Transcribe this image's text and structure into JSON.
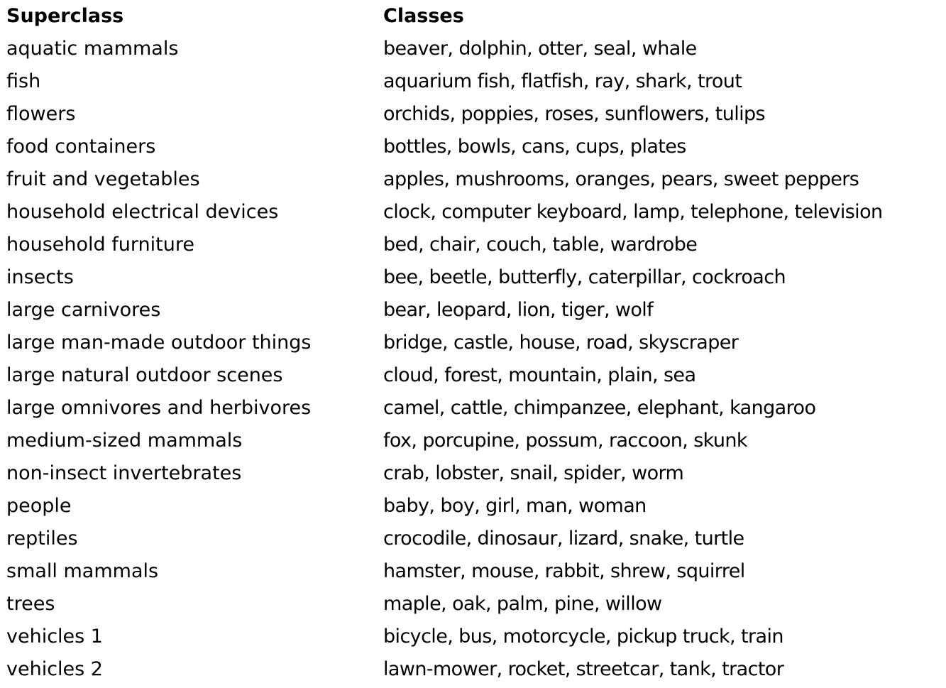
{
  "table": {
    "headers": {
      "superclass": "Superclass",
      "classes": "Classes"
    },
    "rows": [
      {
        "superclass": "aquatic mammals",
        "classes": "beaver, dolphin, otter, seal, whale"
      },
      {
        "superclass": "fish",
        "classes": "aquarium fish, flatfish, ray, shark, trout"
      },
      {
        "superclass": "flowers",
        "classes": "orchids, poppies, roses, sunflowers, tulips"
      },
      {
        "superclass": "food containers",
        "classes": "bottles, bowls, cans, cups, plates"
      },
      {
        "superclass": "fruit and vegetables",
        "classes": "apples, mushrooms, oranges, pears, sweet peppers"
      },
      {
        "superclass": "household electrical devices",
        "classes": "clock, computer keyboard, lamp, telephone, television"
      },
      {
        "superclass": "household furniture",
        "classes": "bed, chair, couch, table, wardrobe"
      },
      {
        "superclass": "insects",
        "classes": "bee, beetle, butterfly, caterpillar, cockroach"
      },
      {
        "superclass": "large carnivores",
        "classes": "bear, leopard, lion, tiger, wolf"
      },
      {
        "superclass": "large man-made outdoor things",
        "classes": "bridge, castle, house, road, skyscraper"
      },
      {
        "superclass": "large natural outdoor scenes",
        "classes": "cloud, forest, mountain, plain, sea"
      },
      {
        "superclass": "large omnivores and herbivores",
        "classes": "camel, cattle, chimpanzee, elephant, kangaroo"
      },
      {
        "superclass": "medium-sized mammals",
        "classes": "fox, porcupine, possum, raccoon, skunk"
      },
      {
        "superclass": "non-insect invertebrates",
        "classes": "crab, lobster, snail, spider, worm"
      },
      {
        "superclass": "people",
        "classes": "baby, boy, girl, man, woman"
      },
      {
        "superclass": "reptiles",
        "classes": "crocodile, dinosaur, lizard, snake, turtle"
      },
      {
        "superclass": "small mammals",
        "classes": "hamster, mouse, rabbit, shrew, squirrel"
      },
      {
        "superclass": "trees",
        "classes": "maple, oak, palm, pine, willow"
      },
      {
        "superclass": "vehicles 1",
        "classes": "bicycle, bus, motorcycle, pickup truck, train"
      },
      {
        "superclass": "vehicles 2",
        "classes": "lawn-mower, rocket, streetcar, tank, tractor"
      }
    ]
  }
}
